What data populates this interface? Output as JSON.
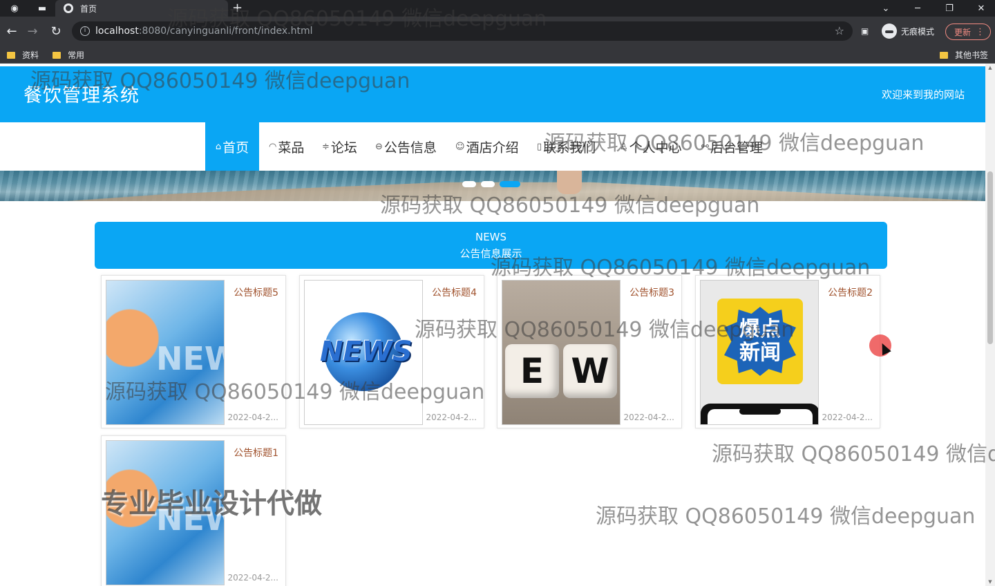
{
  "browser": {
    "tab_title": "首页",
    "url_host": "localhost",
    "url_path": ":8080/canyinguanli/front/index.html",
    "incognito_label": "无痕模式",
    "update_label": "更新",
    "bookmarks": [
      "资料",
      "常用"
    ],
    "other_bookmarks": "其他书签"
  },
  "site": {
    "title": "餐饮管理系统",
    "welcome": "欢迎来到我的网站"
  },
  "nav": [
    {
      "icon": "home-icon",
      "glyph": "⌂",
      "label": "首页",
      "active": true
    },
    {
      "icon": "dish-icon",
      "glyph": "◠",
      "label": "菜品"
    },
    {
      "icon": "forum-icon",
      "glyph": "≑",
      "label": "论坛"
    },
    {
      "icon": "notice-icon",
      "glyph": "⊖",
      "label": "公告信息"
    },
    {
      "icon": "hotel-icon",
      "glyph": "☺",
      "label": "酒店介绍"
    },
    {
      "icon": "contact-icon",
      "glyph": "▯",
      "label": "联系我们"
    },
    {
      "icon": "user-icon",
      "glyph": "♙",
      "label": "个人中心"
    },
    {
      "icon": "link-icon",
      "glyph": "⚯",
      "label": "后台管理"
    }
  ],
  "carousel": {
    "dot_count": 3,
    "active_index": 2
  },
  "news": {
    "en": "NEWS",
    "cn": "公告信息展示",
    "items": [
      {
        "title": "公告标题5",
        "date": "2022-04-2...",
        "image": "news-tv"
      },
      {
        "title": "公告标题4",
        "date": "2022-04-2...",
        "image": "news-globe"
      },
      {
        "title": "公告标题3",
        "date": "2022-04-2...",
        "image": "news-dice"
      },
      {
        "title": "公告标题2",
        "date": "2022-04-2...",
        "image": "news-phone"
      },
      {
        "title": "公告标题1",
        "date": "2022-04-2...",
        "image": "news-tv"
      }
    ],
    "img_text": {
      "tv": "NEW",
      "globe": "NEWS",
      "dice": [
        "E",
        "W"
      ],
      "phone": [
        "爆点",
        "新闻"
      ]
    }
  },
  "watermarks": {
    "repeat": "源码获取 QQ86050149 微信deepguan",
    "cut": "源码获取 QQ86050149 微信d",
    "promo": "专业毕业设计代做"
  },
  "colors": {
    "accent": "#0aa6f4",
    "title_brown": "#a0522d"
  }
}
